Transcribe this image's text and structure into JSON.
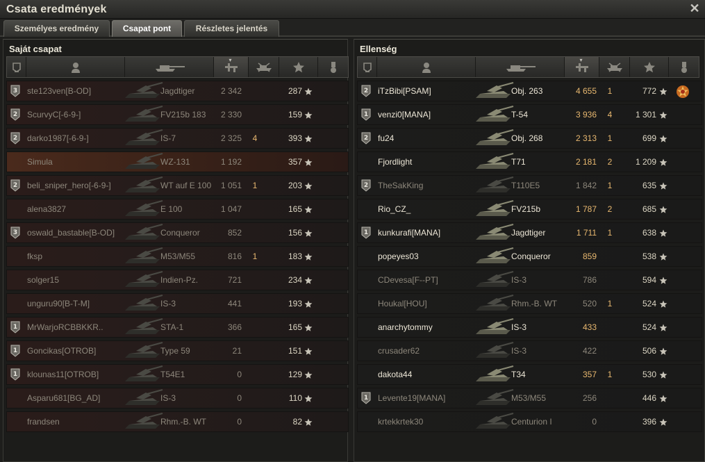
{
  "window": {
    "title": "Csata eredmények",
    "close_label": "✕"
  },
  "tabs": [
    {
      "label": "Személyes eredmény",
      "active": false
    },
    {
      "label": "Csapat pont",
      "active": true
    },
    {
      "label": "Részletes jelentés",
      "active": false
    }
  ],
  "columns": [
    "clan-badge",
    "player",
    "vehicle",
    "damage",
    "kills",
    "experience",
    "medals"
  ],
  "sorted_column": "damage",
  "own_team": {
    "title": "Saját csapat",
    "players": [
      {
        "name": "ste123ven[B-OD]",
        "vehicle": "Jagdtiger",
        "damage": "2 342",
        "kills": "",
        "xp": "287",
        "badge": "3",
        "alive": false,
        "self": false
      },
      {
        "name": "ScurvyC[-6-9-]",
        "vehicle": "FV215b 183",
        "damage": "2 330",
        "kills": "",
        "xp": "159",
        "badge": "2",
        "alive": false,
        "self": false
      },
      {
        "name": "darko1987[-6-9-]",
        "vehicle": "IS-7",
        "damage": "2 325",
        "kills": "4",
        "xp": "393",
        "badge": "2",
        "alive": false,
        "self": false
      },
      {
        "name": "Simula",
        "vehicle": "WZ-131",
        "damage": "1 192",
        "kills": "",
        "xp": "357",
        "badge": "",
        "alive": false,
        "self": true
      },
      {
        "name": "beli_sniper_hero[-6-9-]",
        "vehicle": "WT auf E 100",
        "damage": "1 051",
        "kills": "1",
        "xp": "203",
        "badge": "2",
        "alive": false,
        "self": false
      },
      {
        "name": "alena3827",
        "vehicle": "E 100",
        "damage": "1 047",
        "kills": "",
        "xp": "165",
        "badge": "",
        "alive": false,
        "self": false
      },
      {
        "name": "oswald_bastable[B-OD]",
        "vehicle": "Conqueror",
        "damage": "852",
        "kills": "",
        "xp": "156",
        "badge": "3",
        "alive": false,
        "self": false
      },
      {
        "name": "fksp",
        "vehicle": "M53/M55",
        "damage": "816",
        "kills": "1",
        "xp": "183",
        "badge": "",
        "alive": false,
        "self": false
      },
      {
        "name": "solger15",
        "vehicle": "Indien-Pz.",
        "damage": "721",
        "kills": "",
        "xp": "234",
        "badge": "",
        "alive": false,
        "self": false
      },
      {
        "name": "unguru90[B-T-M]",
        "vehicle": "IS-3",
        "damage": "441",
        "kills": "",
        "xp": "193",
        "badge": "",
        "alive": false,
        "self": false
      },
      {
        "name": "MrWarjoRCBBKKR..",
        "vehicle": "STA-1",
        "damage": "366",
        "kills": "",
        "xp": "165",
        "badge": "1",
        "alive": false,
        "self": false
      },
      {
        "name": "Goncikas[OTROB]",
        "vehicle": "Type 59",
        "damage": "21",
        "kills": "",
        "xp": "151",
        "badge": "1",
        "alive": false,
        "self": false
      },
      {
        "name": "klounas11[OTROB]",
        "vehicle": "T54E1",
        "damage": "0",
        "kills": "",
        "xp": "129",
        "badge": "1",
        "alive": false,
        "self": false
      },
      {
        "name": "Asparu681[BG_AD]",
        "vehicle": "IS-3",
        "damage": "0",
        "kills": "",
        "xp": "110",
        "badge": "",
        "alive": false,
        "self": false
      },
      {
        "name": "frandsen",
        "vehicle": "Rhm.-B. WT",
        "damage": "0",
        "kills": "",
        "xp": "82",
        "badge": "",
        "alive": false,
        "self": false
      }
    ]
  },
  "enemy_team": {
    "title": "Ellenség",
    "players": [
      {
        "name": "iTzBibi[PSAM]",
        "vehicle": "Obj. 263",
        "damage": "4 655",
        "kills": "1",
        "xp": "772",
        "badge": "2",
        "alive": true,
        "medal": true
      },
      {
        "name": "venzi0[MANA]",
        "vehicle": "T-54",
        "damage": "3 936",
        "kills": "4",
        "xp": "1 301",
        "badge": "1",
        "alive": true
      },
      {
        "name": "fu24",
        "vehicle": "Obj. 268",
        "damage": "2 313",
        "kills": "1",
        "xp": "699",
        "badge": "2",
        "alive": true
      },
      {
        "name": "Fjordlight",
        "vehicle": "T71",
        "damage": "2 181",
        "kills": "2",
        "xp": "1 209",
        "badge": "",
        "alive": true
      },
      {
        "name": "TheSakKing",
        "vehicle": "T110E5",
        "damage": "1 842",
        "kills": "1",
        "xp": "635",
        "badge": "2",
        "alive": false
      },
      {
        "name": "Rio_CZ_",
        "vehicle": "FV215b",
        "damage": "1 787",
        "kills": "2",
        "xp": "685",
        "badge": "",
        "alive": true
      },
      {
        "name": "kunkurafi[MANA]",
        "vehicle": "Jagdtiger",
        "damage": "1 711",
        "kills": "1",
        "xp": "638",
        "badge": "1",
        "alive": true
      },
      {
        "name": "popeyes03",
        "vehicle": "Conqueror",
        "damage": "859",
        "kills": "",
        "xp": "538",
        "badge": "",
        "alive": true
      },
      {
        "name": "CDevesa[F--PT]",
        "vehicle": "IS-3",
        "damage": "786",
        "kills": "",
        "xp": "594",
        "badge": "",
        "alive": false
      },
      {
        "name": "Houkal[HOU]",
        "vehicle": "Rhm.-B. WT",
        "damage": "520",
        "kills": "1",
        "xp": "524",
        "badge": "",
        "alive": false
      },
      {
        "name": "anarchytommy",
        "vehicle": "IS-3",
        "damage": "433",
        "kills": "",
        "xp": "524",
        "badge": "",
        "alive": true
      },
      {
        "name": "crusader62",
        "vehicle": "IS-3",
        "damage": "422",
        "kills": "",
        "xp": "506",
        "badge": "",
        "alive": false
      },
      {
        "name": "dakota44",
        "vehicle": "T34",
        "damage": "357",
        "kills": "1",
        "xp": "530",
        "badge": "",
        "alive": true
      },
      {
        "name": "Levente19[MANA]",
        "vehicle": "M53/M55",
        "damage": "256",
        "kills": "",
        "xp": "446",
        "badge": "1",
        "alive": false
      },
      {
        "name": "krtekkrtek30",
        "vehicle": "Centurion I",
        "damage": "0",
        "kills": "",
        "xp": "396",
        "badge": "",
        "alive": false
      }
    ]
  },
  "colors": {
    "damage_alive": "#e8b870",
    "dead_text": "#8d877b",
    "alive_text": "#ece6d6",
    "self_row": "#4a2a1c"
  }
}
